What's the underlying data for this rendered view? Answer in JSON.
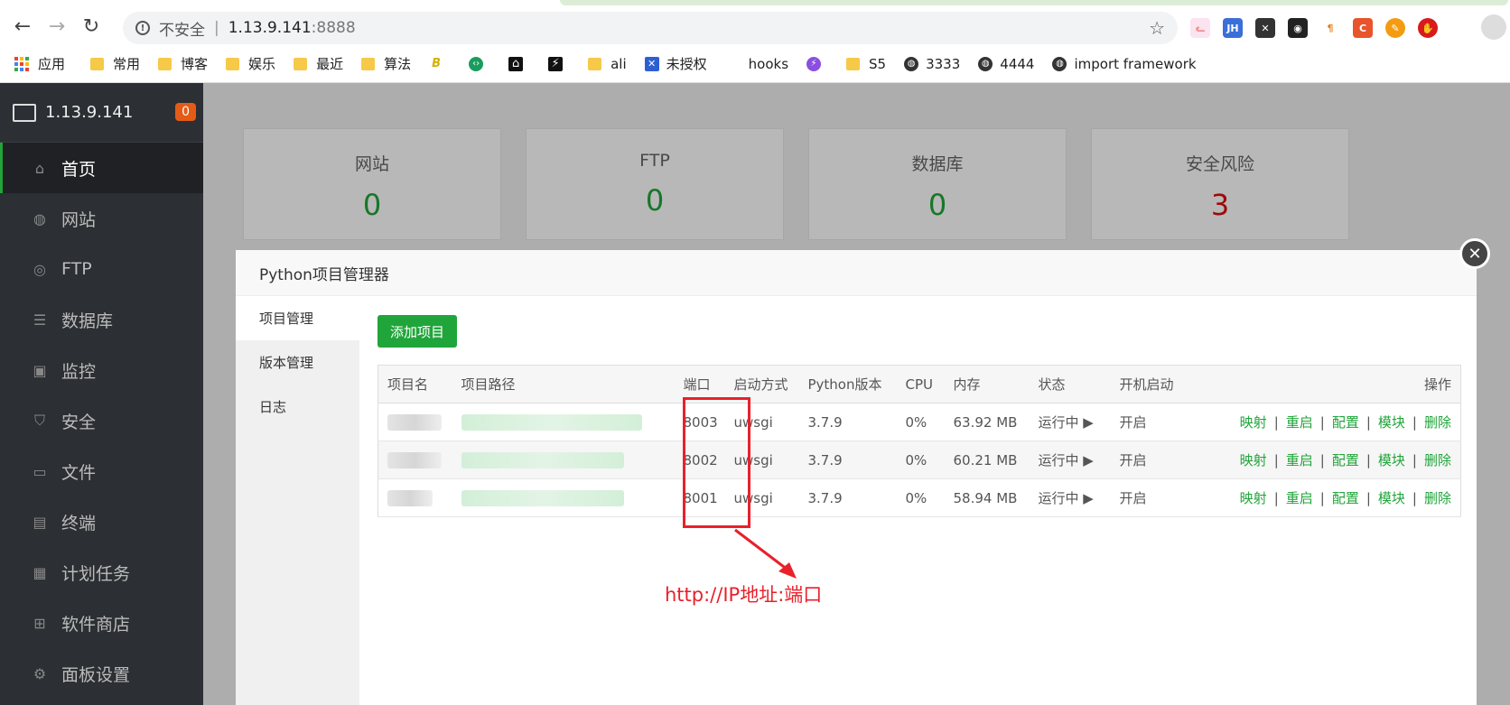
{
  "browser": {
    "security_label": "不安全",
    "separator": "|",
    "host": "1.13.9.141",
    "port": ":8888",
    "bookmarks": [
      {
        "label": "应用",
        "icon": "apps-grid-icon"
      },
      {
        "label": "常用",
        "icon": "folder-icon"
      },
      {
        "label": "博客",
        "icon": "folder-icon"
      },
      {
        "label": "娱乐",
        "icon": "folder-icon"
      },
      {
        "label": "最近",
        "icon": "folder-icon"
      },
      {
        "label": "算法",
        "icon": "folder-icon"
      },
      {
        "label": "",
        "icon": "b-logo-icon"
      },
      {
        "label": "",
        "icon": "green-code-icon"
      },
      {
        "label": "",
        "icon": "graduation-cap-icon"
      },
      {
        "label": "",
        "icon": "plug-icon"
      },
      {
        "label": "ali",
        "icon": "folder-icon"
      },
      {
        "label": "未授权",
        "icon": "blue-x-icon"
      },
      {
        "label": "hooks",
        "icon": ""
      },
      {
        "label": "",
        "icon": "purple-lightning-icon"
      },
      {
        "label": "S5",
        "icon": "folder-icon"
      },
      {
        "label": "3333",
        "icon": "globe-icon"
      },
      {
        "label": "4444",
        "icon": "globe-icon"
      },
      {
        "label": "import framework",
        "icon": "globe-icon"
      }
    ]
  },
  "sidebar": {
    "server": "1.13.9.141",
    "badge": "0",
    "items": [
      {
        "label": "首页",
        "icon": "home-icon"
      },
      {
        "label": "网站",
        "icon": "globe-icon"
      },
      {
        "label": "FTP",
        "icon": "ftp-icon"
      },
      {
        "label": "数据库",
        "icon": "database-icon"
      },
      {
        "label": "监控",
        "icon": "monitor-icon"
      },
      {
        "label": "安全",
        "icon": "shield-icon"
      },
      {
        "label": "文件",
        "icon": "folder-icon"
      },
      {
        "label": "终端",
        "icon": "terminal-icon"
      },
      {
        "label": "计划任务",
        "icon": "calendar-icon"
      },
      {
        "label": "软件商店",
        "icon": "apps-icon"
      },
      {
        "label": "面板设置",
        "icon": "gear-icon"
      }
    ]
  },
  "stats": [
    {
      "title": "网站",
      "value": "0"
    },
    {
      "title": "FTP",
      "value": "0"
    },
    {
      "title": "数据库",
      "value": "0"
    },
    {
      "title": "安全风险",
      "value": "3"
    }
  ],
  "modal": {
    "title": "Python项目管理器",
    "tabs": [
      "项目管理",
      "版本管理",
      "日志"
    ],
    "add_button": "添加项目",
    "columns": [
      "项目名",
      "项目路径",
      "端口",
      "启动方式",
      "Python版本",
      "CPU",
      "内存",
      "状态",
      "开机启动",
      "操作"
    ],
    "rows": [
      {
        "port": "8003",
        "method": "uwsgi",
        "version": "3.7.9",
        "cpu": "0%",
        "mem": "63.92 MB",
        "status": "运行中 ▶",
        "boot": "开启"
      },
      {
        "port": "8002",
        "method": "uwsgi",
        "version": "3.7.9",
        "cpu": "0%",
        "mem": "60.21 MB",
        "status": "运行中 ▶",
        "boot": "开启"
      },
      {
        "port": "8001",
        "method": "uwsgi",
        "version": "3.7.9",
        "cpu": "0%",
        "mem": "58.94 MB",
        "status": "运行中 ▶",
        "boot": "开启"
      }
    ],
    "actions": [
      "映射",
      "重启",
      "配置",
      "模块",
      "删除"
    ]
  },
  "annotation": "http://IP地址:端口"
}
